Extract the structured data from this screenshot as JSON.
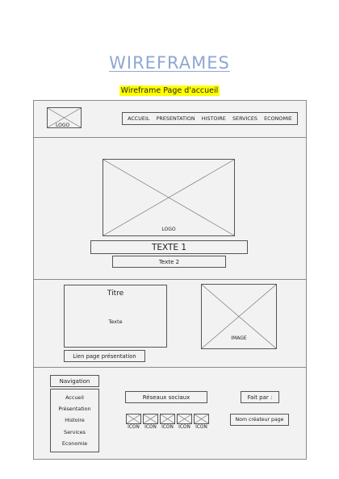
{
  "heading": {
    "title": "WIREFRAMES",
    "subtitle": "Wireframe Page d'accueil"
  },
  "header": {
    "logo_label": "LOGO",
    "nav": [
      "ACCUEIL",
      "PRESENTATION",
      "HISTOIRE",
      "SERVICES",
      "ECONOMIE"
    ]
  },
  "hero": {
    "image_label": "LOGO",
    "text1": "TEXTE 1",
    "text2": "Texte 2"
  },
  "content": {
    "card_title": "Titre",
    "card_text": "Texte",
    "image_label": "IMAGE",
    "link_label": "Lien page présentation"
  },
  "footer": {
    "nav_title": "Navigation",
    "nav_items": [
      "Accueil",
      "Présentation",
      "Histoire",
      "Services",
      "Economie"
    ],
    "social_title": "Réseaux sociaux",
    "icon_label": "ICON",
    "made_by": "Fait par :",
    "creator": "Nom créateur page"
  }
}
